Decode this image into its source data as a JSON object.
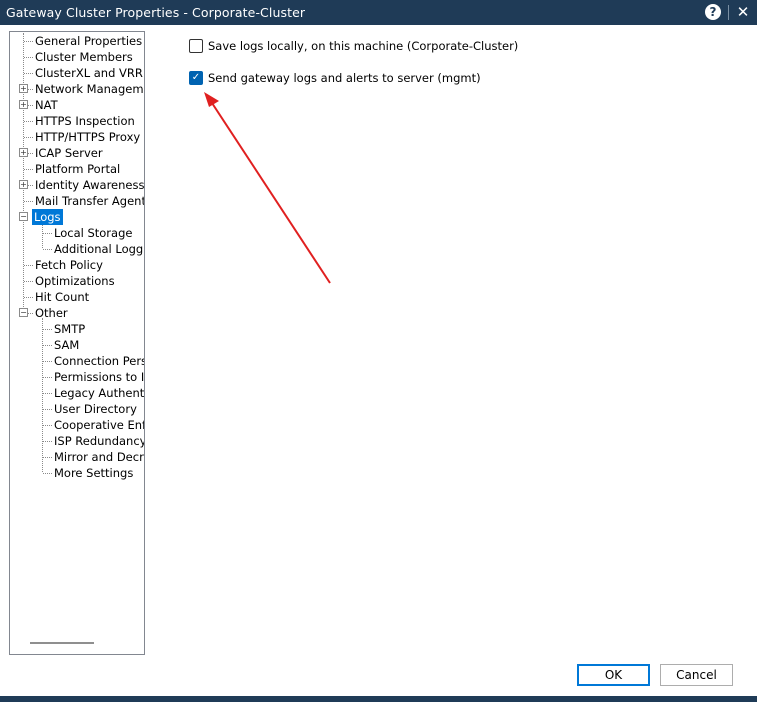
{
  "window": {
    "title": "Gateway Cluster Properties - Corporate-Cluster",
    "help_glyph": "?",
    "close_glyph": "✕"
  },
  "tree": {
    "items": [
      {
        "label": "General Properties"
      },
      {
        "label": "Cluster Members"
      },
      {
        "label": "ClusterXL and VRRP"
      },
      {
        "label": "Network Management",
        "expander": "+"
      },
      {
        "label": "NAT",
        "expander": "+"
      },
      {
        "label": "HTTPS Inspection"
      },
      {
        "label": "HTTP/HTTPS Proxy"
      },
      {
        "label": "ICAP Server",
        "expander": "+"
      },
      {
        "label": "Platform Portal"
      },
      {
        "label": "Identity Awareness",
        "expander": "+"
      },
      {
        "label": "Mail Transfer Agent"
      },
      {
        "label": "Logs",
        "expander": "−",
        "selected": true
      },
      {
        "label": "Local Storage"
      },
      {
        "label": "Additional Logging"
      },
      {
        "label": "Fetch Policy"
      },
      {
        "label": "Optimizations"
      },
      {
        "label": "Hit Count"
      },
      {
        "label": "Other",
        "expander": "−"
      },
      {
        "label": "SMTP"
      },
      {
        "label": "SAM"
      },
      {
        "label": "Connection Persistence"
      },
      {
        "label": "Permissions to Install"
      },
      {
        "label": "Legacy Authentication"
      },
      {
        "label": "User Directory"
      },
      {
        "label": "Cooperative Enforcement"
      },
      {
        "label": "ISP Redundancy"
      },
      {
        "label": "Mirror and Decrypt"
      },
      {
        "label": "More Settings"
      }
    ]
  },
  "logs_page": {
    "save_locally": {
      "label": "Save logs locally, on this machine (Corporate-Cluster)",
      "checked": false
    },
    "send_to_server": {
      "label": "Send gateway logs and alerts to server (mgmt)",
      "checked": true
    },
    "check_glyph": "✓"
  },
  "annotation": {
    "arrow_color": "#e02020"
  },
  "footer": {
    "ok_label": "OK",
    "cancel_label": "Cancel"
  }
}
